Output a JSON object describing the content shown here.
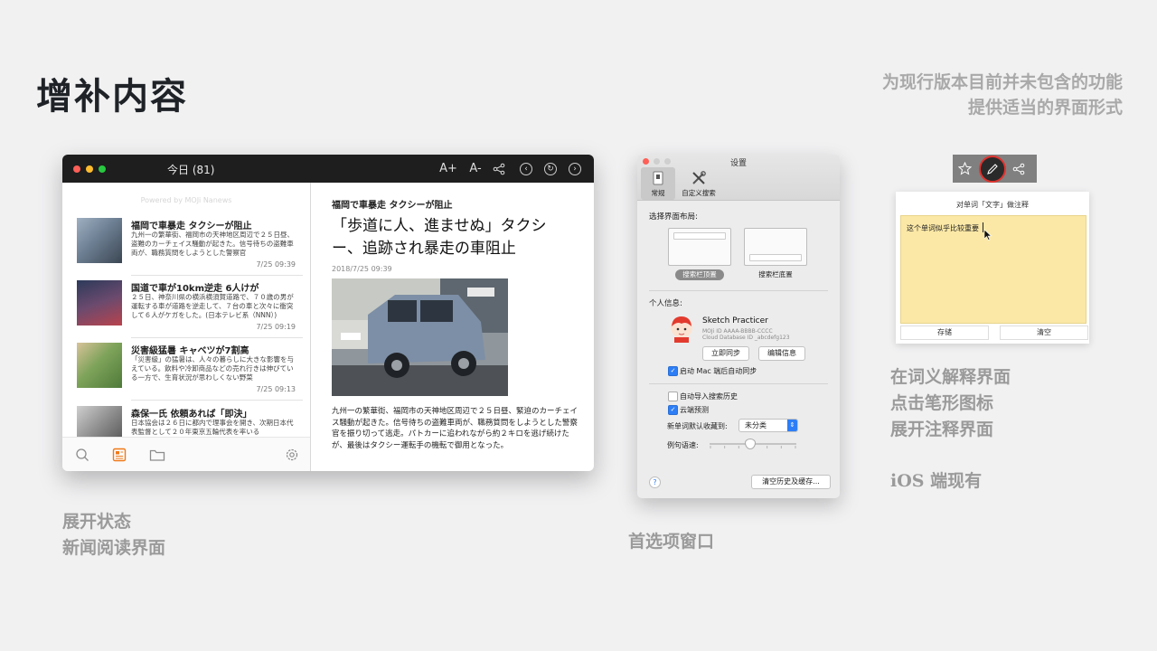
{
  "slide": {
    "title": "增补内容",
    "subtitle_line1": "为现行版本目前并未包含的功能",
    "subtitle_line2": "提供适当的界面形式",
    "caption_news_line1": "展开状态",
    "caption_news_line2": "新闻阅读界面",
    "caption_prefs": "首选项窗口",
    "caption_note_line1": "在词义解释界面",
    "caption_note_line2": "点击笔形图标",
    "caption_note_line3": "展开注释界面",
    "caption_note_line4": "iOS 端现有"
  },
  "news_window": {
    "title": "今日 (81)",
    "toolbar": {
      "font_larger": "A+",
      "font_smaller": "A-"
    },
    "powered_by": "Powered by MOJi Nanews",
    "items": [
      {
        "title": "福岡で車暴走 タクシーが阻止",
        "snippet": "九州一の繁華街、福岡市の天神地区周辺で２５日昼、盗難のカーチェイス騒動が起きた。信号待ちの盗難車両が、職務質問をしようとした警察官",
        "time": "7/25 09:39"
      },
      {
        "title": "国道で車が10km逆走 6人けが",
        "snippet": "２５日、神奈川県の横浜横須賀道路で、７０歳の男が運転する車が道路を逆走して、７台の車と次々に衝突して６人がケガをした。(日本テレビ系（NNN）)",
        "time": "7/25 09:19"
      },
      {
        "title": "災害級猛暑 キャベツが7割高",
        "snippet": "「災害級」の猛暑は、人々の暮らしに大きな影響を与えている。飲料や冷卸商品などの売れ行きは伸びている一方で、生育状況が思わしくない野菜",
        "time": "7/25 09:13"
      },
      {
        "title": "森保一氏 依頼あれば「即決」",
        "snippet": "日本協会は２６日に都内で理事会を開き、次期日本代表監督として２０年東京五輪代表を率いる",
        "time": ""
      }
    ],
    "article": {
      "kicker": "福岡で車暴走 タクシーが阻止",
      "headline": "「歩道に人、進ませぬ」タクシー、追跡され暴走の車阻止",
      "date": "2018/7/25 09:39",
      "body": "九州一の繁華街、福岡市の天神地区周辺で２５日昼、緊迫のカーチェイス騒動が起きた。信号待ちの盗難車両が、職務質問をしようとした警察官を振り切って逃走。パトカーに追われながら約２キロを逃げ続けたが、最後はタクシー運転手の機転で御用となった。"
    }
  },
  "prefs_window": {
    "title": "设置",
    "tabs": [
      "常规",
      "自定义搜索"
    ],
    "layout_label": "选择界面布局:",
    "layout_options": [
      "搜索栏顶置",
      "搜索栏底置"
    ],
    "personal_label": "个人信息:",
    "user_name": "Sketch Practicer",
    "user_id": "MOJi ID AAAA-BBBB-CCCC",
    "cloud_id": "Cloud Database ID _abcdefg123",
    "sync_button": "立即同步",
    "edit_button": "编辑信息",
    "auto_sync": "启动 Mac 端后自动同步",
    "import_history": "自动导入搜索历史",
    "cloud_predict": "云端预测",
    "collect_label": "新单词默认收藏到:",
    "collect_value": "未分类",
    "speed_label": "例句语速:",
    "speed_level": 0.45,
    "clear_button": "清空历史及缓存...",
    "help": "?"
  },
  "note_panel": {
    "title": "对单词「文字」做注释",
    "text": "这个单词似乎比较重要",
    "save_button": "存储",
    "clear_button": "清空"
  },
  "colors": {
    "accent": "#f07a1a",
    "note_yellow": "#fbe8a6",
    "checkbox_blue": "#2d7ef6",
    "highlight_ring": "#e0332f"
  }
}
